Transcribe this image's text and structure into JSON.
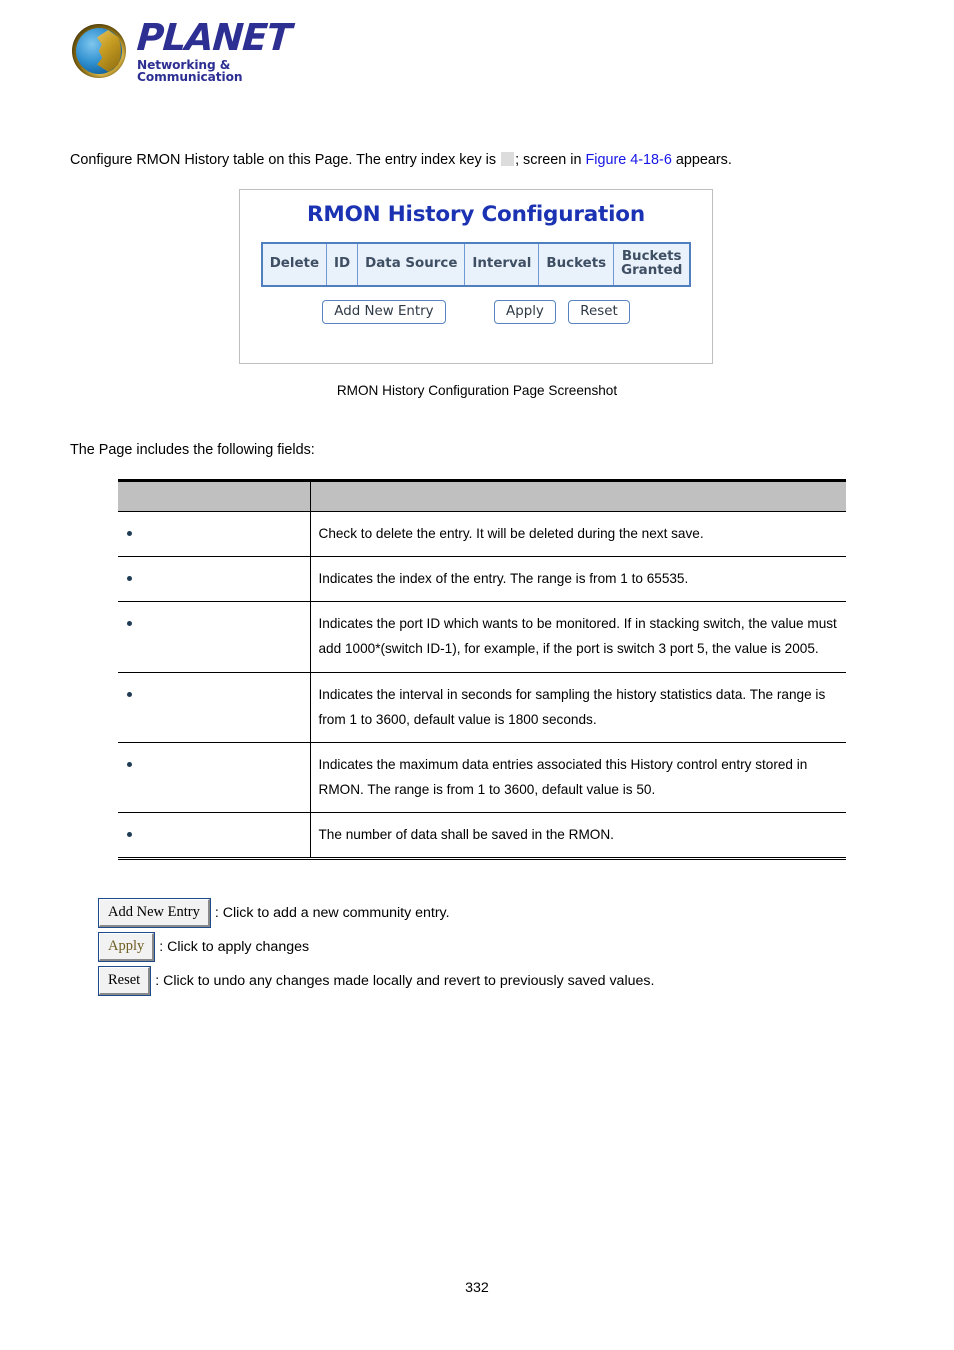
{
  "brand": {
    "name": "PLANET",
    "tagline": "Networking & Communication",
    "logo_icon": "planet-globe-logo"
  },
  "intro": {
    "part1": "Configure RMON History table on this Page. The entry index key is",
    "blank_placeholder": "",
    "part2": "; screen in",
    "xref": "Figure 4-18-6",
    "part3": "appears."
  },
  "figure": {
    "title": "RMON History Configuration",
    "table_headers": [
      "Delete",
      "ID",
      "Data Source",
      "Interval",
      "Buckets",
      "Buckets Granted"
    ],
    "buttons": [
      "Add New Entry",
      "Apply",
      "Reset"
    ],
    "caption": "RMON History Configuration Page Screenshot",
    "colors": {
      "title": "#1b33b3",
      "header_bg": "#e9f1fb",
      "header_border": "#6f9ad4",
      "header_text": "#3f4f63",
      "button_border": "#5784c0",
      "box_border": "#bfbfbf"
    }
  },
  "includes_line": "The Page includes the following fields:",
  "fields_table": {
    "headers": [
      "",
      ""
    ],
    "rows": [
      {
        "object": "",
        "description": "Check to delete the entry. It will be deleted during the next save."
      },
      {
        "object": "",
        "description": "Indicates the index of the entry. The range is from 1 to 65535."
      },
      {
        "object": "",
        "description": "Indicates the port ID which wants to be monitored. If in stacking switch, the value must add 1000*(switch ID-1), for example, if the port is switch 3 port 5, the value is 2005."
      },
      {
        "object": "",
        "description": "Indicates the interval in seconds for sampling the history statistics data. The range is from 1 to 3600, default value is 1800 seconds."
      },
      {
        "object": "",
        "description": "Indicates the maximum data entries associated this History control entry stored in RMON. The range is from 1 to 3600, default value is 50."
      },
      {
        "object": "",
        "description": "The number of data shall be saved in the RMON."
      }
    ]
  },
  "legend": [
    {
      "button": "Add New Entry",
      "text": ": Click to add a new community entry."
    },
    {
      "button": "Apply",
      "text": ": Click to apply changes"
    },
    {
      "button": "Reset",
      "text": ": Click to undo any changes made locally and revert to previously saved values."
    }
  ],
  "footer": {
    "page_number": "332"
  }
}
